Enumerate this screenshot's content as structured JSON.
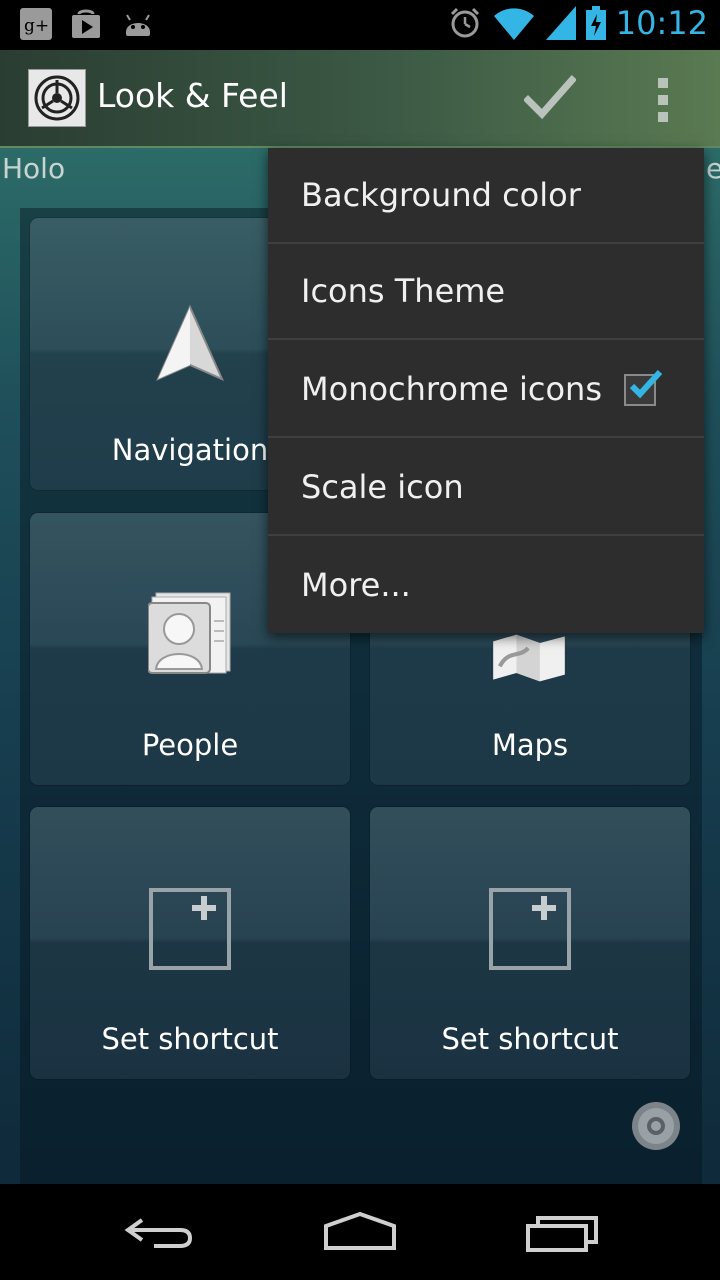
{
  "status_bar": {
    "left_icons": [
      "google-plus-icon",
      "play-store-icon",
      "android-icon"
    ],
    "right_icons": [
      "alarm-icon",
      "wifi-icon",
      "signal-icon",
      "battery-charging-icon"
    ],
    "time": "10:12",
    "accent_color": "#33b5e5"
  },
  "action_bar": {
    "title": "Look & Feel",
    "icons": [
      "app-icon",
      "check-icon",
      "overflow-menu-icon"
    ]
  },
  "content": {
    "theme_label": "Holo",
    "theme_label_right": "e",
    "tiles": [
      {
        "label": "Navigation",
        "icon": "navigation-arrow-icon"
      },
      {
        "label": "",
        "icon": ""
      },
      {
        "label": "People",
        "icon": "people-contact-icon"
      },
      {
        "label": "Maps",
        "icon": "maps-icon"
      },
      {
        "label": "Set shortcut",
        "icon": "add-shortcut-icon"
      },
      {
        "label": "Set shortcut",
        "icon": "add-shortcut-icon"
      }
    ]
  },
  "menu": {
    "items": [
      {
        "label": "Background color"
      },
      {
        "label": "Icons Theme"
      },
      {
        "label": "Monochrome icons",
        "checked": true
      },
      {
        "label": "Scale icon"
      },
      {
        "label": "More..."
      }
    ]
  },
  "nav_bar": {
    "buttons": [
      "back-icon",
      "home-icon",
      "recents-icon"
    ]
  }
}
